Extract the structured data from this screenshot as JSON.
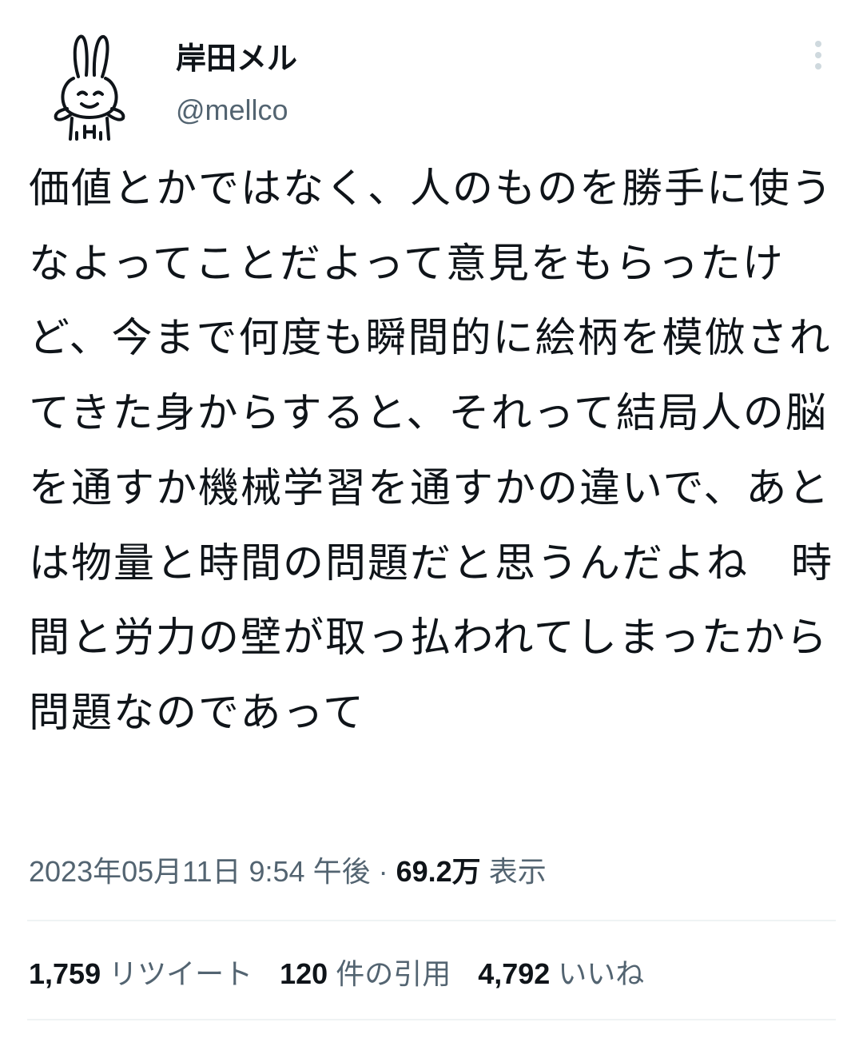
{
  "user": {
    "display_name": "岸田メル",
    "handle": "@mellco",
    "avatar_icon": "rabbit-doodle-avatar-icon"
  },
  "tweet": {
    "text": "価値とかではなく、人のものを勝手に使うなよってことだよって意見をもらったけど、今まで何度も瞬間的に絵柄を模倣されてきた身からすると、それって結局人の脳を通すか機械学習を通すかの違いで、あとは物量と時間の問題だと思うんだよね　時間と労力の壁が取っ払われてしまったから問題なのであって"
  },
  "meta": {
    "timestamp": "2023年05月11日 9:54 午後",
    "separator": "·",
    "views_count": "69.2万",
    "views_label": "表示"
  },
  "stats": {
    "retweets_count": "1,759",
    "retweets_label": "リツイート",
    "quotes_count": "120",
    "quotes_label": "件の引用",
    "likes_count": "4,792",
    "likes_label": "いいね"
  },
  "colors": {
    "text_primary": "#0f1419",
    "text_secondary": "#536471",
    "divider": "#eff3f4",
    "more_icon": "#cfd9de"
  }
}
